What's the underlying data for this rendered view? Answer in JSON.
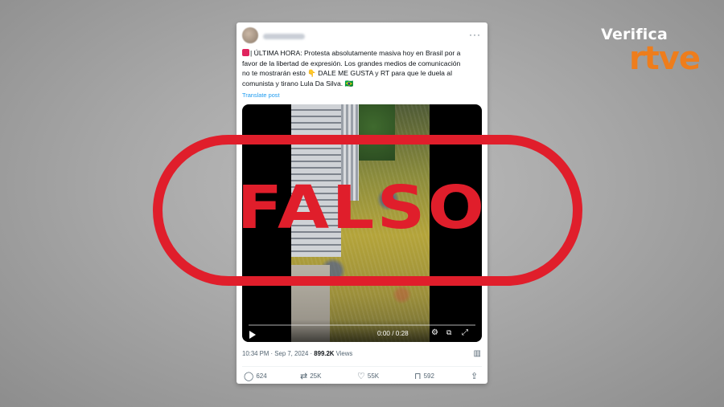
{
  "brand": {
    "verifica": "Verifica",
    "rtve": "rtve"
  },
  "tweet": {
    "text_line1": "| ÚLTIMA HORA: Protesta absolutamente masiva hoy en Brasil por a",
    "text_line2": "favor de la libertad de expresión. Los grandes medios de comunicación",
    "text_line3": "no te mostrarán esto 👇 DALE ME GUSTA y RT para que le duela al",
    "text_line4": "comunista y tirano Lula Da Silva. 🇧🇷",
    "translate": "Translate post",
    "more": "···"
  },
  "video": {
    "time": "0:00 / 0:28",
    "progress": 0
  },
  "overlay": {
    "label": "FALSO",
    "color": "#e01e2b"
  },
  "meta": {
    "time": "10:34 PM · Sep 7, 2024 ·",
    "views_count": "899.2K",
    "views_label": "Views"
  },
  "actions": {
    "replies": "624",
    "reposts": "25K",
    "likes": "55K",
    "bookmarks": "592"
  },
  "colors": {
    "accent": "#1d9bf0",
    "brand_orange": "#ee7d1c"
  }
}
